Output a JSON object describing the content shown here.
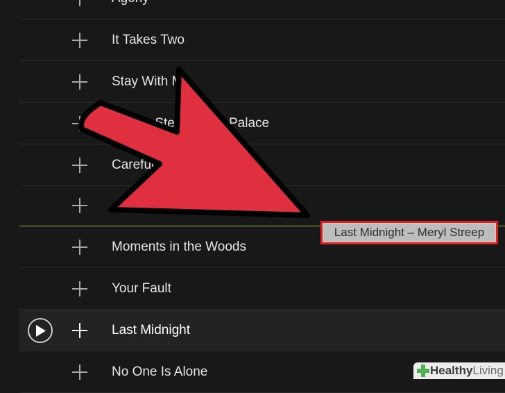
{
  "tracks": [
    {
      "title": "Agony"
    },
    {
      "title": "It Takes Two"
    },
    {
      "title": "Stay With Me"
    },
    {
      "title": "On the Steps of the Palace"
    },
    {
      "title": "Careful"
    },
    {
      "title": ""
    },
    {
      "title": "Moments in the Woods"
    },
    {
      "title": "Your Fault"
    },
    {
      "title": "Last Midnight"
    },
    {
      "title": "No One Is Alone"
    }
  ],
  "drag_tooltip": {
    "text": "Last Midnight – Meryl Streep"
  },
  "watermark": {
    "word1": "Healthy",
    "word2": "Living"
  },
  "colors": {
    "background": "#181818",
    "drop_indicator": "#8bc34a",
    "highlight_box": "#e02020",
    "arrow": "#e0303f"
  },
  "icons": {
    "add": "plus-icon",
    "play": "play-icon",
    "annotation": "arrow-icon"
  }
}
